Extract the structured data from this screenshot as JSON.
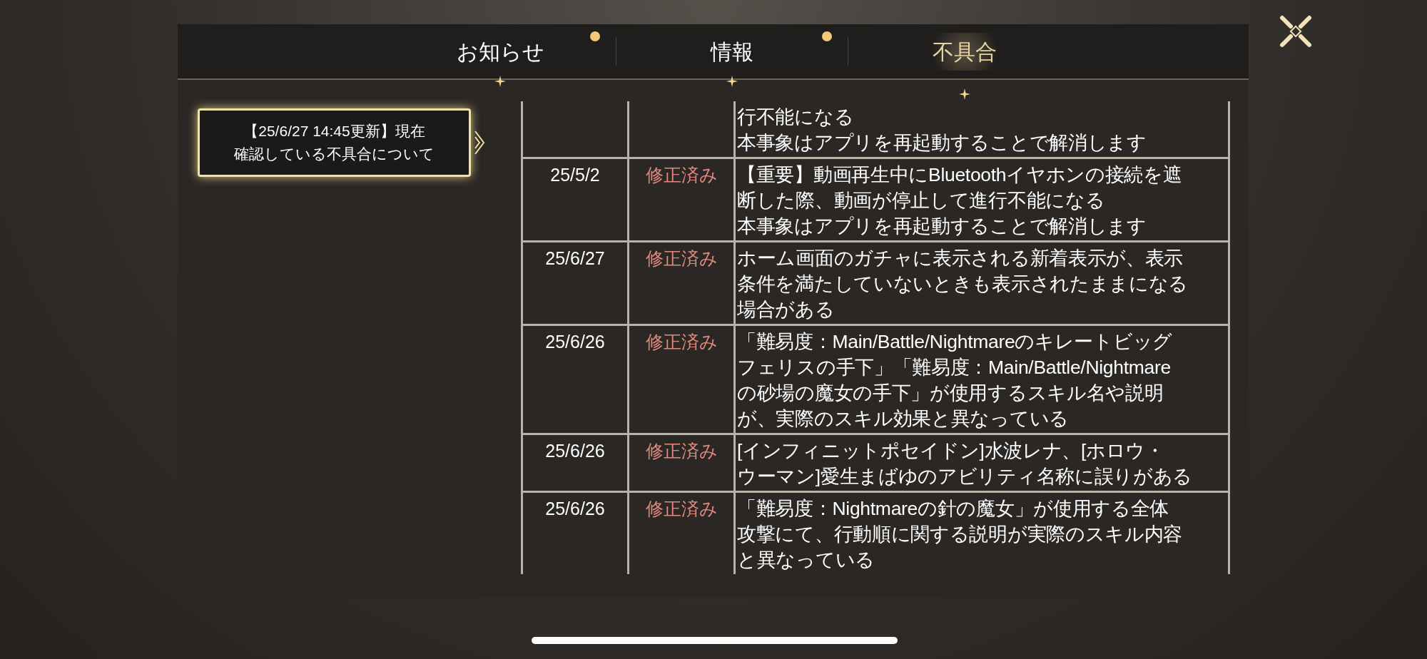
{
  "tabs": [
    {
      "label": "お知らせ",
      "selected": false,
      "badge": true
    },
    {
      "label": "情報",
      "selected": false,
      "badge": true
    },
    {
      "label": "不具合",
      "selected": true,
      "badge": false
    }
  ],
  "sidebar": {
    "items": [
      {
        "lines": [
          "【25/6/27 14:45更新】現在",
          "確認している不具合について"
        ],
        "selected": true
      }
    ]
  },
  "table": {
    "rows": [
      {
        "date": "",
        "status": "",
        "description": [
          "行不能になる",
          "本事象はアプリを再起動することで解消します"
        ]
      },
      {
        "date": "25/5/2",
        "status": "修正済み",
        "description": [
          "【重要】動画再生中にBluetoothイヤホンの接続を遮",
          "断した際、動画が停止して進行不能になる",
          "本事象はアプリを再起動することで解消します"
        ]
      },
      {
        "date": "25/6/27",
        "status": "修正済み",
        "description": [
          "ホーム画面のガチャに表示される新着表示が、表示",
          "条件を満たしていないときも表示されたままになる",
          "場合がある"
        ]
      },
      {
        "date": "25/6/26",
        "status": "修正済み",
        "description": [
          "「難易度：Main/Battle/Nightmareのキレートビッグ",
          "フェリスの手下」「難易度：Main/Battle/Nightmare",
          "の砂場の魔女の手下」が使用するスキル名や説明",
          "が、実際のスキル効果と異なっている"
        ]
      },
      {
        "date": "25/6/26",
        "status": "修正済み",
        "description": [
          "[インフィニットポセイドン]水波レナ、[ホロウ・",
          "ウーマン]愛生まばゆのアビリティ名称に誤りがある"
        ]
      },
      {
        "date": "25/6/26",
        "status": "修正済み",
        "description": [
          "「難易度：Nightmareの針の魔女」が使用する全体",
          "攻撃にて、行動順に関する説明が実際のスキル内容",
          "と異なっている"
        ]
      }
    ]
  }
}
